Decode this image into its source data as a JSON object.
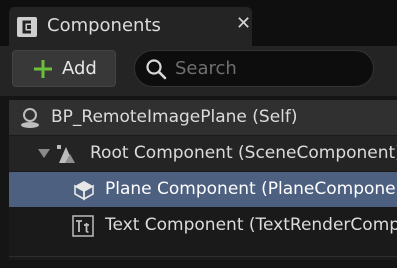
{
  "tab": {
    "title": "Components",
    "close_glyph": "✕",
    "icon": "components-panel-icon"
  },
  "toolbar": {
    "add_label": "Add",
    "add_icon": "plus-icon",
    "search_placeholder": "Search",
    "search_value": "",
    "search_icon": "search-icon"
  },
  "tree": {
    "items": [
      {
        "label": "BP_RemoteImagePlane (Self)",
        "icon": "actor-self-icon",
        "selected": false
      },
      {
        "label": "Root Component (SceneComponent)",
        "icon": "scene-component-icon",
        "expanded": true,
        "selected": false
      },
      {
        "label": "Plane Component (PlaneComponent)",
        "icon": "static-mesh-cube-icon",
        "selected": true
      },
      {
        "label": "Text Component (TextRenderComponent)",
        "icon": "text-render-icon",
        "selected": false
      }
    ]
  },
  "colors": {
    "selection": "#4d6080",
    "accent_green": "#6dbf3a",
    "background": "#151515"
  }
}
